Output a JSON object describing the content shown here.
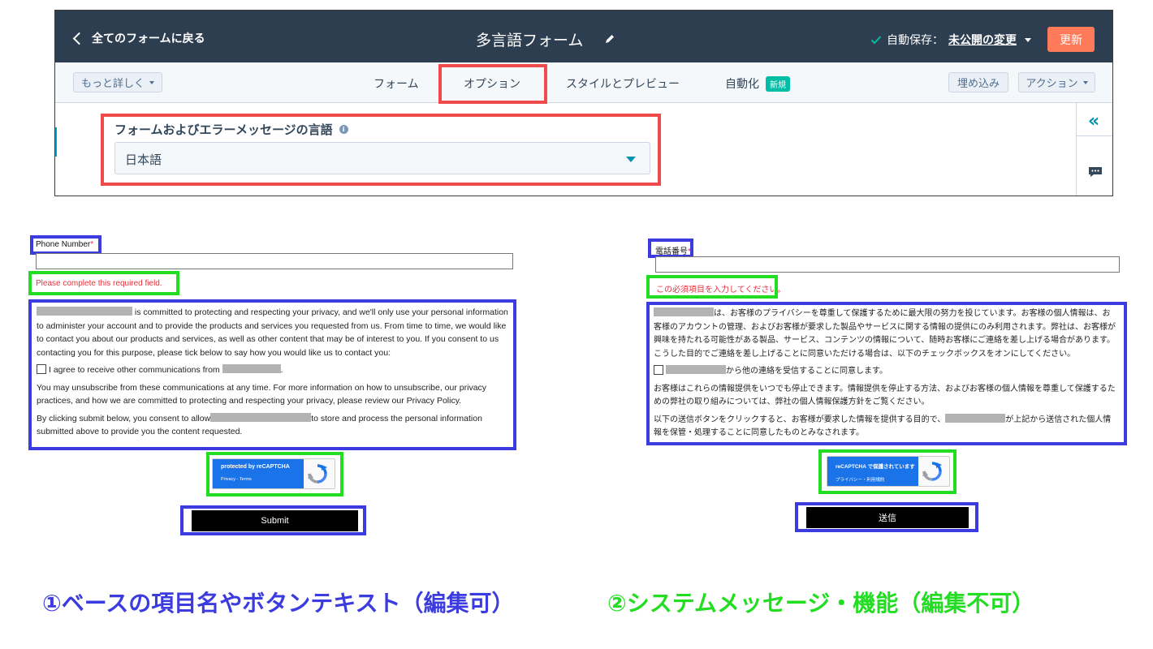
{
  "editor": {
    "back_label": "全てのフォームに戻る",
    "title": "多言語フォーム",
    "autosave_prefix": "自動保存：",
    "autosave_link": "未公開の変更",
    "update_button": "更新",
    "more_button": "もっと詳しく",
    "tabs": [
      {
        "label": "フォーム"
      },
      {
        "label": "オプション"
      },
      {
        "label": "スタイルとプレビュー"
      },
      {
        "label": "自動化",
        "badge": "新規"
      }
    ],
    "embed_button": "埋め込み",
    "action_button": "アクション",
    "language_label": "フォームおよびエラーメッセージの言語",
    "language_value": "日本語",
    "collapse_glyph": "«",
    "colors": {
      "topbar": "#2d3e50",
      "update": "#ff7a59",
      "highlight": "#ef4b4b",
      "teal": "#00a4bd"
    }
  },
  "english_form": {
    "field_label": "Phone Number",
    "required_mark": "*",
    "error": "Please complete this required field.",
    "consent_1": "is committed to protecting and respecting your privacy, and we'll only use your personal information to administer your account and to provide the products and services you requested from us. From time to time, we would like to contact you about our products and services, as well as other content that may be of interest to you. If you consent to us contacting you for this purpose, please tick below to say how you would like us to contact you:",
    "checkbox_label": "I agree to receive other communications from",
    "checkbox_suffix": ".",
    "consent_2": "You may unsubscribe from these communications at any time. For more information on how to unsubscribe, our privacy practices, and how we are committed to protecting and respecting your privacy, please review our Privacy Policy.",
    "consent_3_a": "By clicking submit below, you consent to allow",
    "consent_3_b": "to store and process the personal information submitted above to provide you the content requested.",
    "recaptcha_title": "protected by reCAPTCHA",
    "recaptcha_sub": "Privacy - Terms",
    "submit": "Submit"
  },
  "japanese_form": {
    "field_label": "電話番号",
    "required_mark": "*",
    "error": "この必須項目を入力してください。",
    "consent_1": "は、お客様のプライバシーを尊重して保護するために最大限の努力を投じています。お客様の個人情報は、お客様のアカウントの管理、およびお客様が要求した製品やサービスに関する情報の提供にのみ利用されます。弊社は、お客様が興味を持たれる可能性がある製品、サービス、コンテンツの情報について、随時お客様にご連絡を差し上げる場合があります。こうした目的でご連絡を差し上げることに同意いただける場合は、以下のチェックボックスをオンにしてください。",
    "checkbox_label": "から他の連絡を受信することに同意します。",
    "consent_2": "お客様はこれらの情報提供をいつでも停止できます。情報提供を停止する方法、およびお客様の個人情報を尊重して保護するための弊社の取り組みについては、弊社の個人情報保護方針をご覧ください。",
    "consent_3_a": "以下の送信ボタンをクリックすると、お客様が要求した情報を提供する目的で、",
    "consent_3_b": "が上記から送信された個人情報を保管・処理することに同意したものとみなされます。",
    "recaptcha_title": "reCAPTCHA で保護されています",
    "recaptcha_sub": "プライバシー・利用規約",
    "submit": "送信"
  },
  "captions": {
    "left": "①ベースの項目名やボタンテキスト（編集可）",
    "right": "②システムメッセージ・機能（編集不可）",
    "colors": {
      "left": "#3b3be0",
      "right": "#22dd22"
    }
  }
}
